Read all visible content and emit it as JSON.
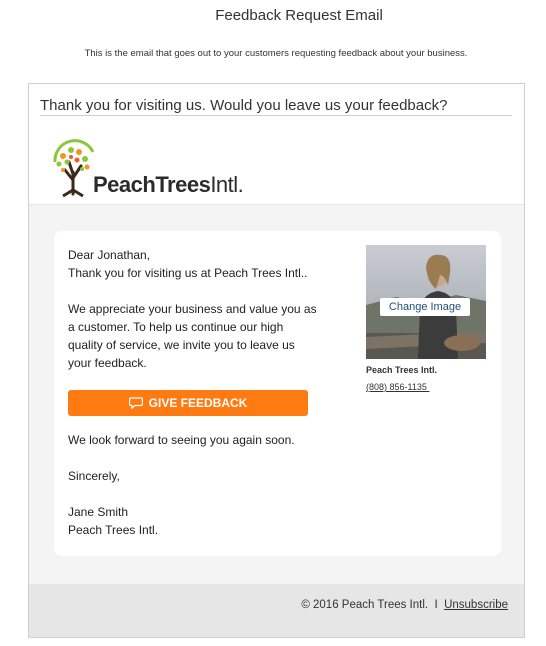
{
  "page": {
    "title": "Feedback Request Email",
    "subtitle": "This is the email that goes out to your customers requesting feedback about your business."
  },
  "email": {
    "subject": "Thank you for visiting us. Would you leave us your feedback?",
    "logo": {
      "brand_bold": "PeachTrees",
      "brand_light": "Intl."
    },
    "letter": {
      "greeting": "Dear Jonathan,",
      "thanks": "Thank you for visiting us at Peach Trees Intl..",
      "body": "We appreciate your business and value you as a customer. To help us continue our high quality of service, we invite you to leave us your feedback."
    },
    "button": {
      "label": "GIVE FEEDBACK",
      "color": "#ff7b12"
    },
    "closing": {
      "line": "We look forward to seeing you again soon.",
      "signoff": "Sincerely,",
      "name": "Jane Smith",
      "company": "Peach Trees Intl."
    },
    "profile": {
      "change_image_label": "Change Image",
      "business_name": "Peach Trees Intl.",
      "phone": "(808) 856-1135 "
    },
    "footer": {
      "copyright": "© 2016 Peach Trees Intl.",
      "separator": "I",
      "unsubscribe": "Unsubscribe"
    }
  }
}
